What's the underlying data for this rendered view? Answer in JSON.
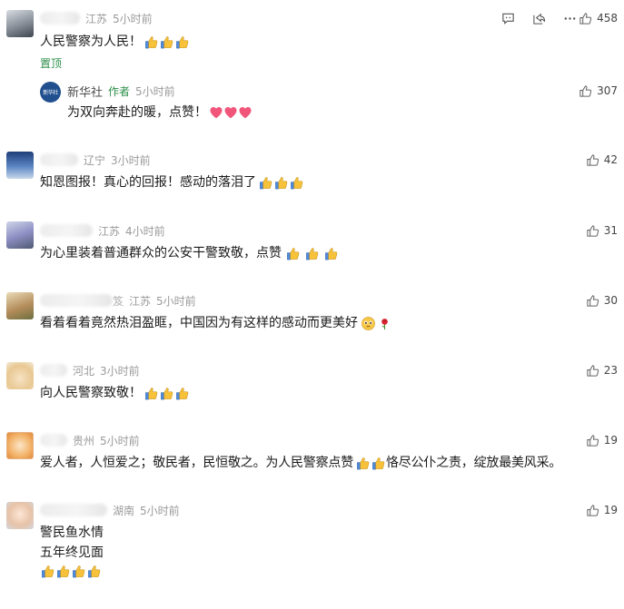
{
  "pinned_label": "置顶",
  "author_tag": "作者",
  "comments": [
    {
      "location": "江苏",
      "time": "5小时前",
      "text": "人民警察为人民！",
      "likes": "458",
      "thumbs": 3
    },
    {
      "location": "辽宁",
      "time": "3小时前",
      "text": "知恩图报！真心的回报！感动的落泪了",
      "likes": "42",
      "thumbs": 3
    },
    {
      "location": "江苏",
      "time": "4小时前",
      "text": "为心里装着普通群众的公安干警致敬，点赞",
      "likes": "31",
      "thumbs": 3
    },
    {
      "location": "江苏",
      "time": "5小时前",
      "name_suffix": "笈",
      "text": "看着看着竟然热泪盈眶，中国因为有这样的感动而更美好",
      "likes": "30"
    },
    {
      "location": "河北",
      "time": "3小时前",
      "text": "向人民警察致敬！",
      "likes": "23",
      "thumbs": 3
    },
    {
      "location": "贵州",
      "time": "5小时前",
      "text_a": "爱人者，人恒爱之；敬民者，民恒敬之。为人民警察点赞",
      "text_b": "恪尽公仆之责，绽放最美风采。",
      "likes": "19"
    },
    {
      "location": "湖南",
      "time": "5小时前",
      "line1": "警民鱼水情",
      "line2": "五年终见面",
      "likes": "19",
      "thumbs": 4
    }
  ],
  "reply": {
    "author": "新华社",
    "time": "5小时前",
    "text": "为双向奔赴的暖，点赞！",
    "likes": "307",
    "hearts": 3
  },
  "icons": {
    "comment": "comment-icon",
    "share": "share-icon",
    "more": "more-icon",
    "like": "thumbs-up-icon"
  },
  "colors": {
    "pinned": "#2d8f4a",
    "meta": "#9a9a9a",
    "heart": "#f2557a"
  }
}
